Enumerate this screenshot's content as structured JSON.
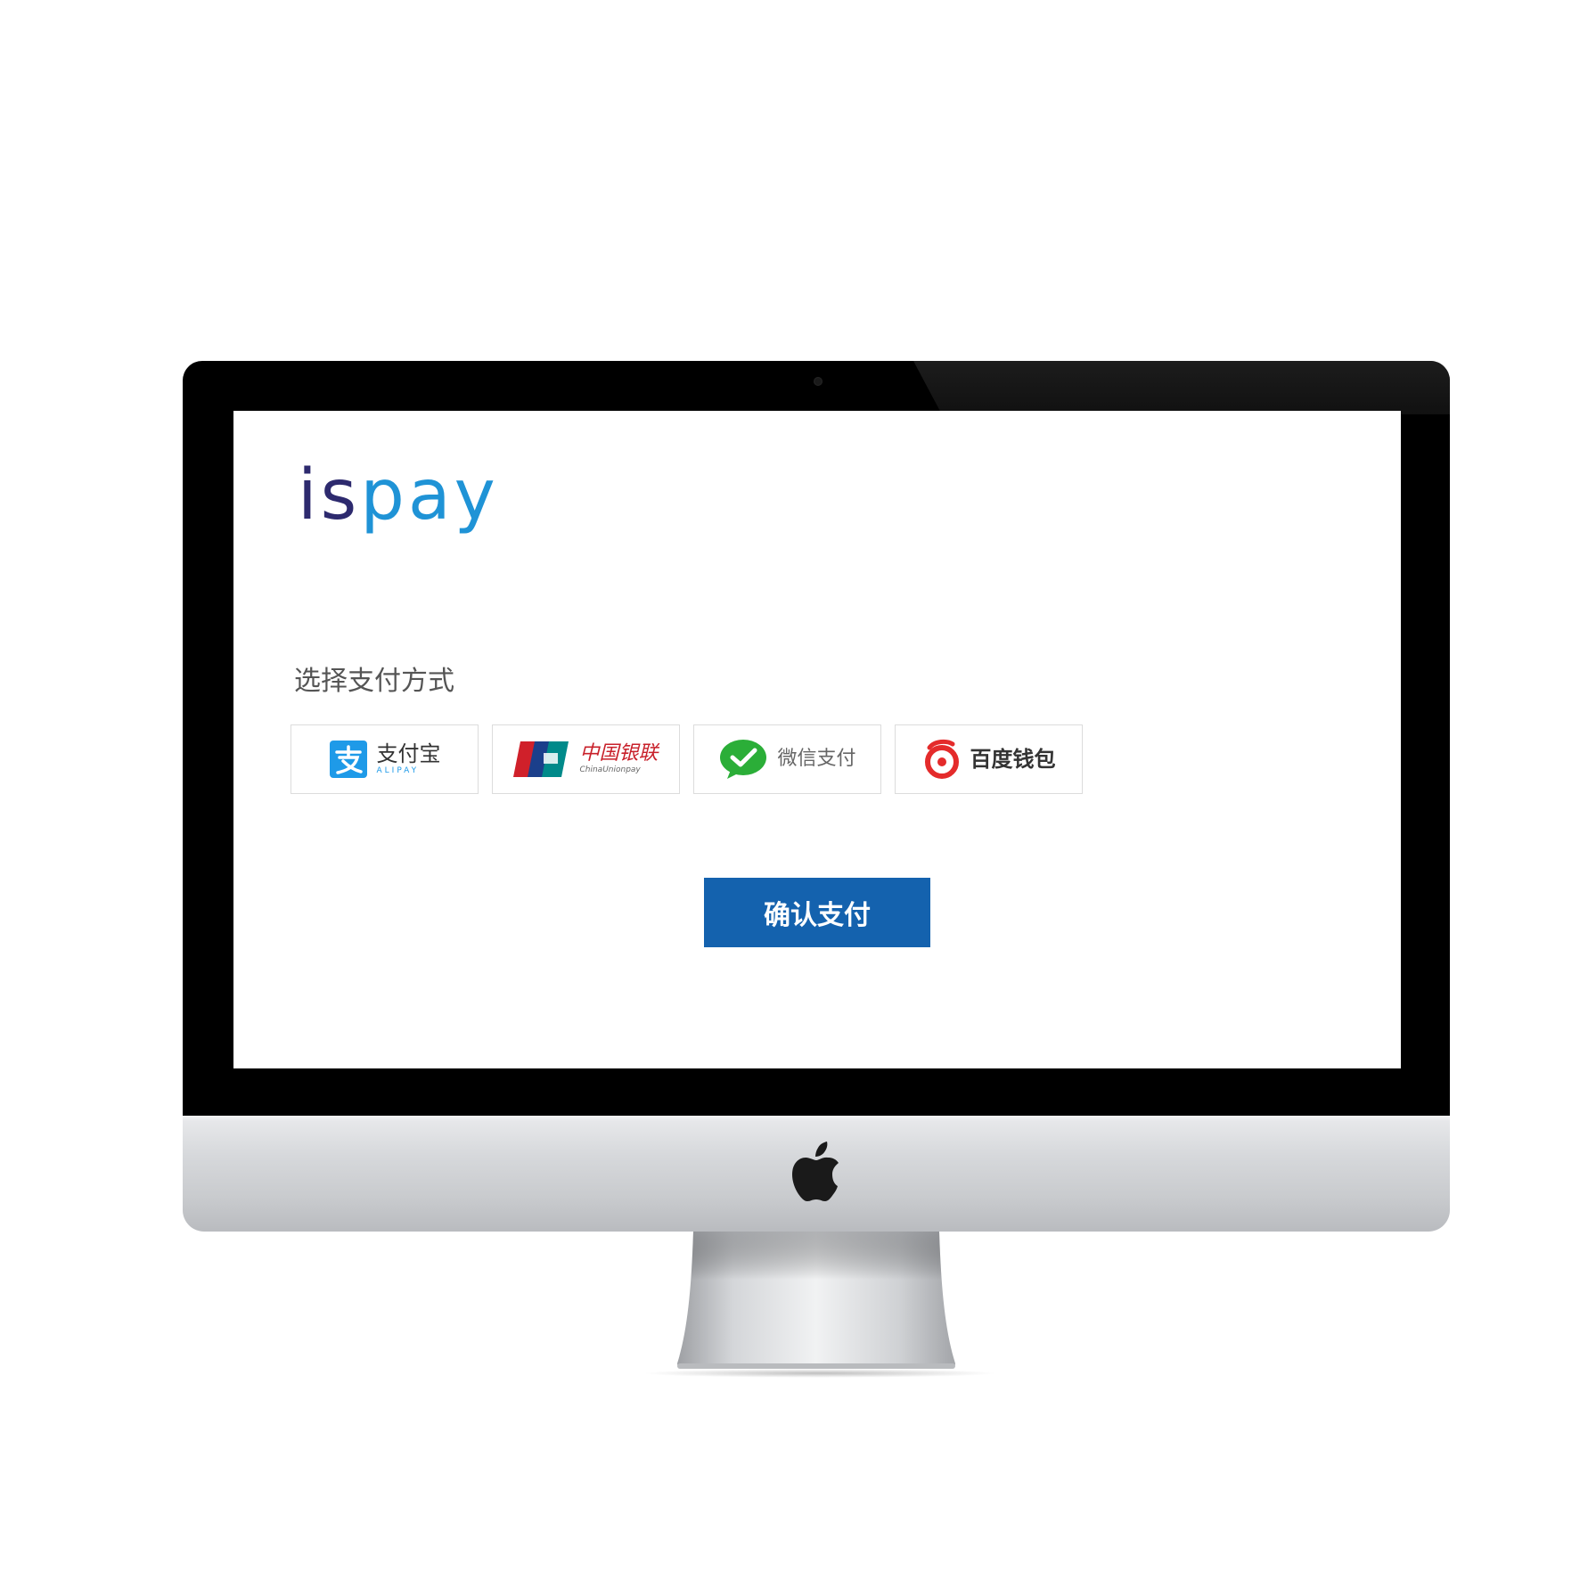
{
  "screen": {
    "brand": {
      "part1": "is",
      "part2": "pay"
    },
    "section_title": "选择支付方式",
    "payment_methods": [
      {
        "label": "支付宝",
        "sublabel": "ALIPAY",
        "icon": "alipay-icon",
        "color": "#1e9ae8"
      },
      {
        "label": "中国银联",
        "sublabel": "ChinaUnionpay",
        "icon": "unionpay-icon",
        "color": "#d0202a"
      },
      {
        "label": "微信支付",
        "icon": "wechat-pay-icon",
        "color": "#2bae38"
      },
      {
        "label": "百度钱包",
        "icon": "baidu-wallet-icon",
        "color": "#e42b2b"
      }
    ],
    "confirm_label": "确认支付",
    "confirm_color": "#1462ae"
  },
  "device": {
    "logo": "apple-logo-icon"
  }
}
